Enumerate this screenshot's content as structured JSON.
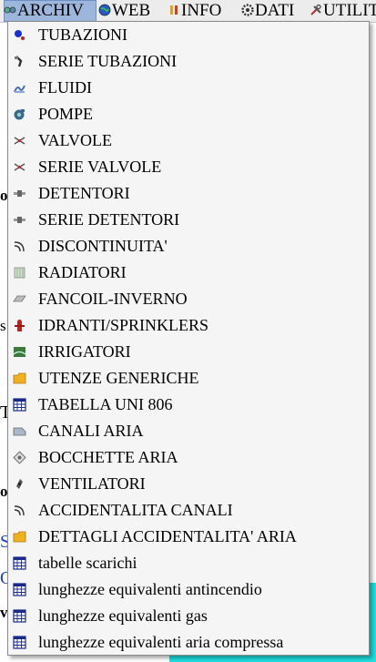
{
  "menubar": {
    "items": [
      {
        "label": "ARCHIV",
        "icon": "archive-icon"
      },
      {
        "label": "WEB",
        "icon": "globe-icon"
      },
      {
        "label": "INFO",
        "icon": "info-icon"
      },
      {
        "label": "DATI",
        "icon": "gear-icon"
      },
      {
        "label": "UTILIT",
        "icon": "tools-icon"
      }
    ]
  },
  "background": {
    "fragments": [
      "o",
      "s",
      "T",
      "ol",
      "S",
      "O",
      "v"
    ]
  },
  "archivio_menu": {
    "items": [
      {
        "label": "TUBAZIONI",
        "icon": "pipe-icon"
      },
      {
        "label": "SERIE TUBAZIONI",
        "icon": "pipe-series-icon"
      },
      {
        "label": "FLUIDI",
        "icon": "fluid-icon"
      },
      {
        "label": "POMPE",
        "icon": "pump-icon"
      },
      {
        "label": "VALVOLE",
        "icon": "valve-icon"
      },
      {
        "label": "SERIE VALVOLE",
        "icon": "valve-series-icon"
      },
      {
        "label": "DETENTORI",
        "icon": "detentor-icon"
      },
      {
        "label": "SERIE DETENTORI",
        "icon": "detentor-series-icon"
      },
      {
        "label": "DISCONTINUITA'",
        "icon": "discontinuity-icon"
      },
      {
        "label": "RADIATORI",
        "icon": "radiator-icon"
      },
      {
        "label": "FANCOIL-INVERNO",
        "icon": "fancoil-icon"
      },
      {
        "label": "IDRANTI/SPRINKLERS",
        "icon": "hydrant-icon"
      },
      {
        "label": "IRRIGATORI",
        "icon": "irrigator-icon"
      },
      {
        "label": "UTENZE GENERICHE",
        "icon": "folder-icon"
      },
      {
        "label": "TABELLA UNI 806",
        "icon": "table-icon"
      },
      {
        "label": "CANALI ARIA",
        "icon": "air-duct-icon"
      },
      {
        "label": "BOCCHETTE ARIA",
        "icon": "air-vent-icon"
      },
      {
        "label": "VENTILATORI",
        "icon": "fan-icon"
      },
      {
        "label": "ACCIDENTALITA CANALI",
        "icon": "duct-fitting-icon"
      },
      {
        "label": "DETTAGLI ACCIDENTALITA' ARIA",
        "icon": "folder-icon"
      },
      {
        "label": "tabelle scarichi",
        "icon": "table-icon"
      },
      {
        "label": "lunghezze equivalenti antincendio",
        "icon": "table-icon"
      },
      {
        "label": "lunghezze equivalenti gas",
        "icon": "table-icon"
      },
      {
        "label": "lunghezze equivalenti aria compressa",
        "icon": "table-icon"
      }
    ]
  }
}
